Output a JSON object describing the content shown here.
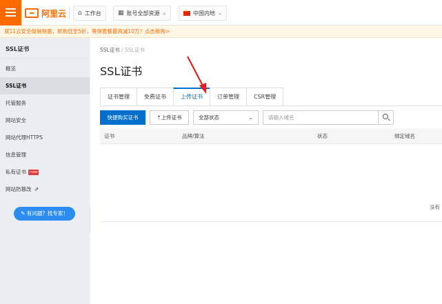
{
  "topbar": {
    "logo_text": "阿里云",
    "workbench_label": "工作台",
    "account_label": "账号全部资源",
    "region_label": "中国内地"
  },
  "promo": {
    "text": "双11云安全促销特惠，新购低至5折，等保套餐最高减10万！点击抢购>"
  },
  "sidebar": {
    "title": "SSL证书",
    "items": [
      {
        "label": "概览"
      },
      {
        "label": "SSL证书"
      },
      {
        "label": "托管服务"
      },
      {
        "label": "网站安全"
      },
      {
        "label": "网站代理HTTPS"
      },
      {
        "label": "信息管理"
      },
      {
        "label": "私有证书",
        "badge": "new"
      },
      {
        "label": "网站防篡改"
      }
    ],
    "help_button": "有问题？找专家！"
  },
  "main": {
    "breadcrumb": [
      "SSL证书",
      "/",
      "SSL证书"
    ],
    "title": "SSL证书",
    "tabs": [
      {
        "label": "证书管理"
      },
      {
        "label": "免费证书"
      },
      {
        "label": "上传证书",
        "active": true
      },
      {
        "label": "订单管理"
      },
      {
        "label": "CSR管理"
      }
    ],
    "toolbar": {
      "buy_button": "快捷购买证书",
      "upload_button": "上传证书",
      "status_select": "全部状态",
      "search_placeholder": "请输入域名"
    },
    "table": {
      "columns": [
        "证书",
        "品牌/算法",
        "状态",
        "绑定域名"
      ],
      "empty_text": "没有"
    }
  },
  "colors": {
    "brand_orange": "#ff6a00",
    "primary_blue": "#0070cc",
    "annotation_red": "#e02020"
  }
}
